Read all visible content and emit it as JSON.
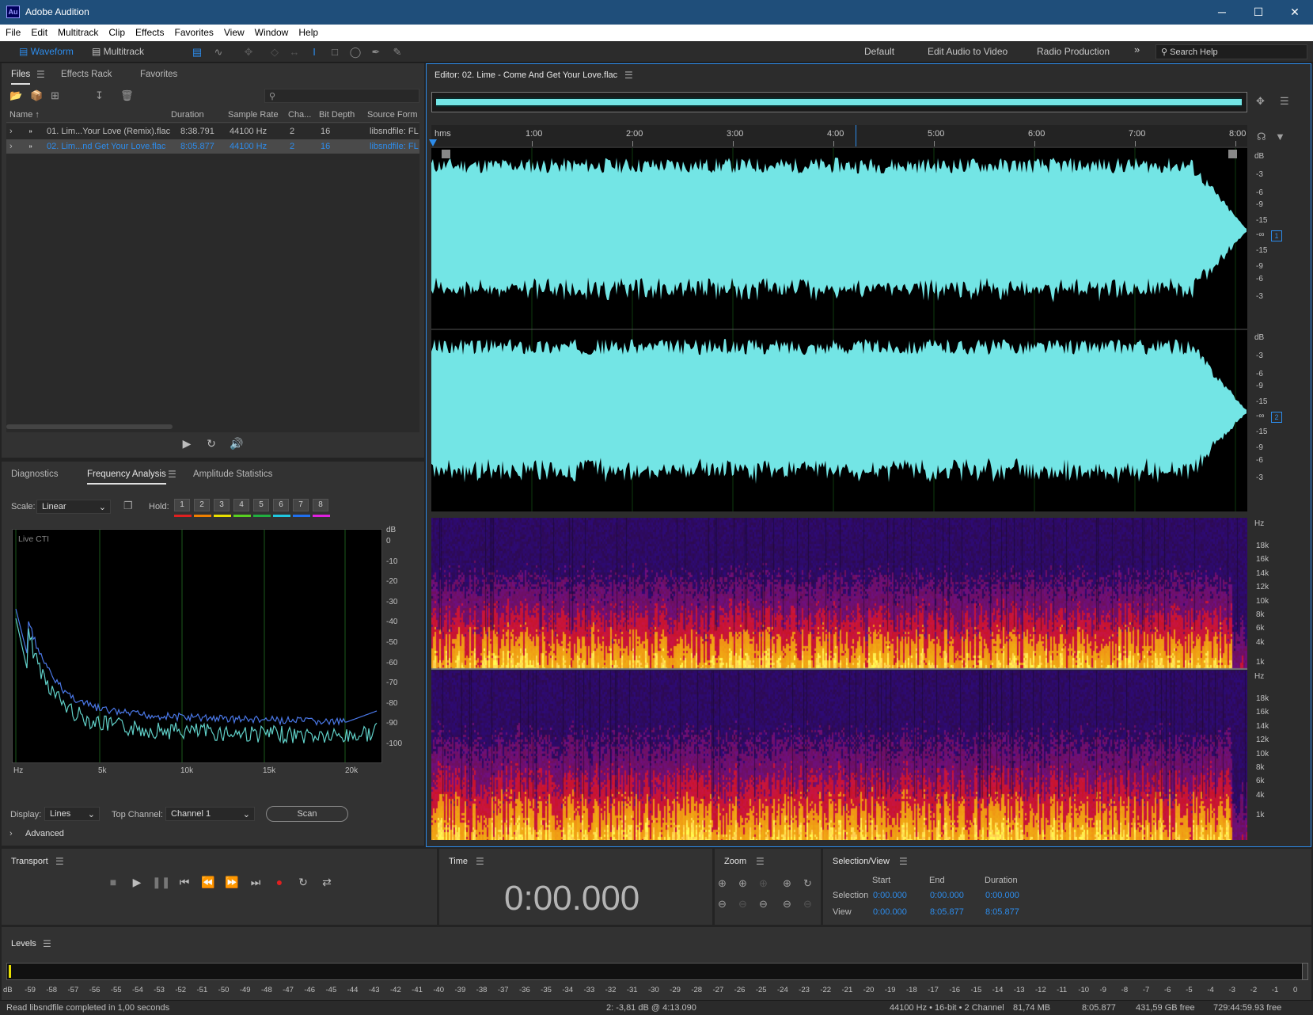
{
  "app": {
    "title": "Adobe Audition",
    "logo": "Au"
  },
  "window_controls": {
    "minimize": "─",
    "maximize": "☐",
    "close": "✕"
  },
  "menu": [
    "File",
    "Edit",
    "Multitrack",
    "Clip",
    "Effects",
    "Favorites",
    "View",
    "Window",
    "Help"
  ],
  "toolbar": {
    "waveform": "Waveform",
    "multitrack": "Multitrack",
    "workspaces": [
      "Default",
      "Edit Audio to Video",
      "Radio Production"
    ],
    "more": "»",
    "search": "Search Help"
  },
  "files_panel": {
    "tabs": [
      "Files",
      "Effects Rack",
      "Favorites"
    ],
    "columns": [
      "Name",
      "Duration",
      "Sample Rate",
      "Cha...",
      "Bit Depth",
      "Source Form"
    ],
    "rows": [
      {
        "name": "01. Lim...Your Love (Remix).flac",
        "duration": "8:38.791",
        "rate": "44100 Hz",
        "ch": "2",
        "bits": "16",
        "src": "libsndfile: FL"
      },
      {
        "name": "02. Lim...nd Get Your Love.flac",
        "duration": "8:05.877",
        "rate": "44100 Hz",
        "ch": "2",
        "bits": "16",
        "src": "libsndfile: FL"
      }
    ]
  },
  "analysis_panel": {
    "tabs": [
      "Diagnostics",
      "Frequency Analysis",
      "Amplitude Statistics"
    ],
    "scale_label": "Scale:",
    "scale_value": "Linear",
    "hold_label": "Hold:",
    "hold": [
      "1",
      "2",
      "3",
      "4",
      "5",
      "6",
      "7",
      "8"
    ],
    "hold_colors": [
      "#e02020",
      "#f08000",
      "#e8e000",
      "#58d020",
      "#20b040",
      "#20c8e0",
      "#2070f0",
      "#e020e0"
    ],
    "graph_label": "Live CTI",
    "db_ticks": [
      "dB",
      "0",
      "-10",
      "-20",
      "-30",
      "-40",
      "-50",
      "-60",
      "-70",
      "-80",
      "-90",
      "-100"
    ],
    "hz_ticks": [
      "Hz",
      "5k",
      "10k",
      "15k",
      "20k"
    ],
    "display_label": "Display:",
    "display_value": "Lines",
    "top_channel_label": "Top Channel:",
    "top_channel_value": "Channel 1",
    "scan": "Scan",
    "advanced": "Advanced"
  },
  "editor": {
    "title": "Editor: 02. Lime - Come And Get Your Love.flac",
    "time_ticks": [
      "hms",
      "1:00",
      "2:00",
      "3:00",
      "4:00",
      "5:00",
      "6:00",
      "7:00",
      "8:00"
    ],
    "db_labels": [
      "dB",
      "-3",
      "-6",
      "-9",
      "-15",
      "-∞",
      "-15",
      "-9",
      "-6",
      "-3"
    ],
    "channels": [
      "1",
      "2"
    ],
    "hz_labels": [
      "Hz",
      "18k",
      "16k",
      "14k",
      "12k",
      "10k",
      "8k",
      "6k",
      "4k",
      "1k"
    ],
    "waveform_color": "#73e5e5"
  },
  "transport": {
    "title": "Transport"
  },
  "time": {
    "title": "Time",
    "value": "0:00.000"
  },
  "zoom": {
    "title": "Zoom"
  },
  "selview": {
    "title": "Selection/View",
    "cols": [
      "Start",
      "End",
      "Duration"
    ],
    "rows": [
      {
        "label": "Selection",
        "start": "0:00.000",
        "end": "0:00.000",
        "duration": "0:00.000"
      },
      {
        "label": "View",
        "start": "0:00.000",
        "end": "8:05.877",
        "duration": "8:05.877"
      }
    ]
  },
  "levels": {
    "title": "Levels",
    "scale": [
      "dB",
      "-59",
      "-58",
      "-57",
      "-56",
      "-55",
      "-54",
      "-53",
      "-52",
      "-51",
      "-50",
      "-49",
      "-48",
      "-47",
      "-46",
      "-45",
      "-44",
      "-43",
      "-42",
      "-41",
      "-40",
      "-39",
      "-38",
      "-37",
      "-36",
      "-35",
      "-34",
      "-33",
      "-32",
      "-31",
      "-30",
      "-29",
      "-28",
      "-27",
      "-26",
      "-25",
      "-24",
      "-23",
      "-22",
      "-21",
      "-20",
      "-19",
      "-18",
      "-17",
      "-16",
      "-15",
      "-14",
      "-13",
      "-12",
      "-11",
      "-10",
      "-9",
      "-8",
      "-7",
      "-6",
      "-5",
      "-4",
      "-3",
      "-2",
      "-1",
      "0"
    ]
  },
  "status": {
    "left": "Read libsndfile completed in 1,00 seconds",
    "cursor": "2: -3,81 dB @ 4:13.090",
    "format": "44100 Hz • 16-bit • 2 Channel",
    "size": "81,74 MB",
    "duration": "8:05.877",
    "free": "431,59 GB free",
    "free_time": "729:44:59.93 free"
  }
}
